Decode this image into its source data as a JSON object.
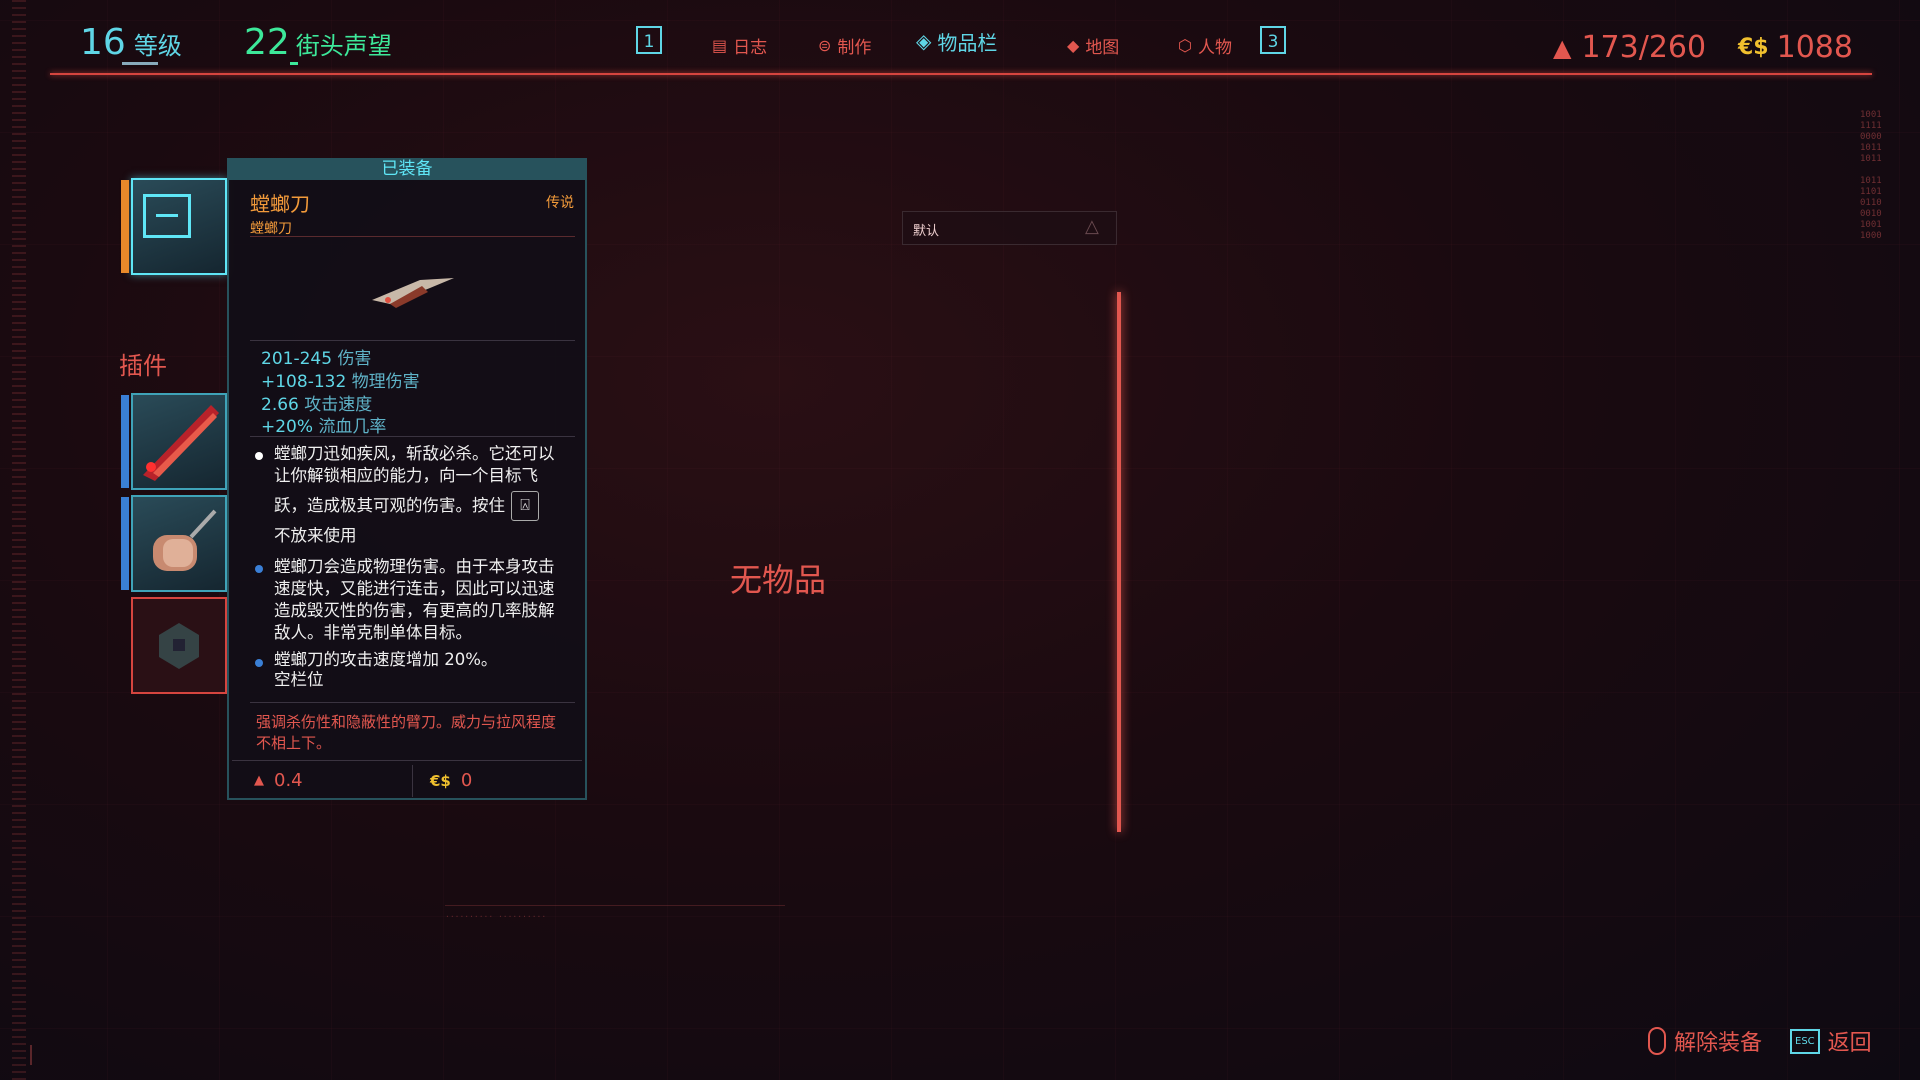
{
  "header": {
    "level_value": "16",
    "level_label": "等级",
    "street_cred_value": "22",
    "street_cred_label": "街头声望",
    "left_key": "1",
    "right_key": "3",
    "tabs": [
      {
        "label": "日志",
        "icon": "journal-icon"
      },
      {
        "label": "制作",
        "icon": "crafting-icon"
      },
      {
        "label": "物品栏",
        "icon": "inventory-icon"
      },
      {
        "label": "地图",
        "icon": "map-icon"
      },
      {
        "label": "人物",
        "icon": "character-icon"
      }
    ],
    "active_tab": "物品栏",
    "weight": "173/260",
    "money_symbol": "€$",
    "money": "1088"
  },
  "sidebar": {
    "mods_label": "插件"
  },
  "tooltip": {
    "equipped_label": "已装备",
    "item_name": "螳螂刀",
    "item_subtitle": "螳螂刀",
    "rarity": "传说",
    "stats": [
      {
        "value": "201-245",
        "label": "伤害"
      },
      {
        "value": "+108-132",
        "label": "物理伤害"
      },
      {
        "value": "2.66",
        "label": "攻击速度"
      },
      {
        "value": "+20%",
        "label": "流血几率"
      }
    ],
    "desc1_line1": "螳螂刀迅如疾风，斩敌必杀。它还可以",
    "desc1_line2": "让你解锁相应的能力，向一个目标飞",
    "desc1_line3": "跃，造成极其可观的伤害。按住",
    "desc1_line4": "不放来使用",
    "desc2_line1": "螳螂刀会造成物理伤害。由于本身攻击",
    "desc2_line2": "速度快，又能进行连击，因此可以迅速",
    "desc2_line3": "造成毁灭性的伤害，有更高的几率肢解",
    "desc2_line4": "敌人。非常克制单体目标。",
    "desc3_line1": "螳螂刀的攻击速度增加 20%。",
    "desc3_line2": "空栏位",
    "flavor_line1": "强调杀伤性和隐蔽性的臂刀。威力与拉风程度",
    "flavor_line2": "不相上下。",
    "weight": "0.4",
    "money_symbol": "€$",
    "price": "0"
  },
  "sort": {
    "label": "默认"
  },
  "main": {
    "empty_text": "无物品"
  },
  "footer": {
    "unequip_label": "解除装备",
    "esc_key": "ESC",
    "back_label": "返回"
  },
  "colors": {
    "accent_red": "#e2574f",
    "accent_cyan": "#5fd6e6",
    "cred_green": "#3de89a",
    "legendary_orange": "#f29a3a"
  }
}
